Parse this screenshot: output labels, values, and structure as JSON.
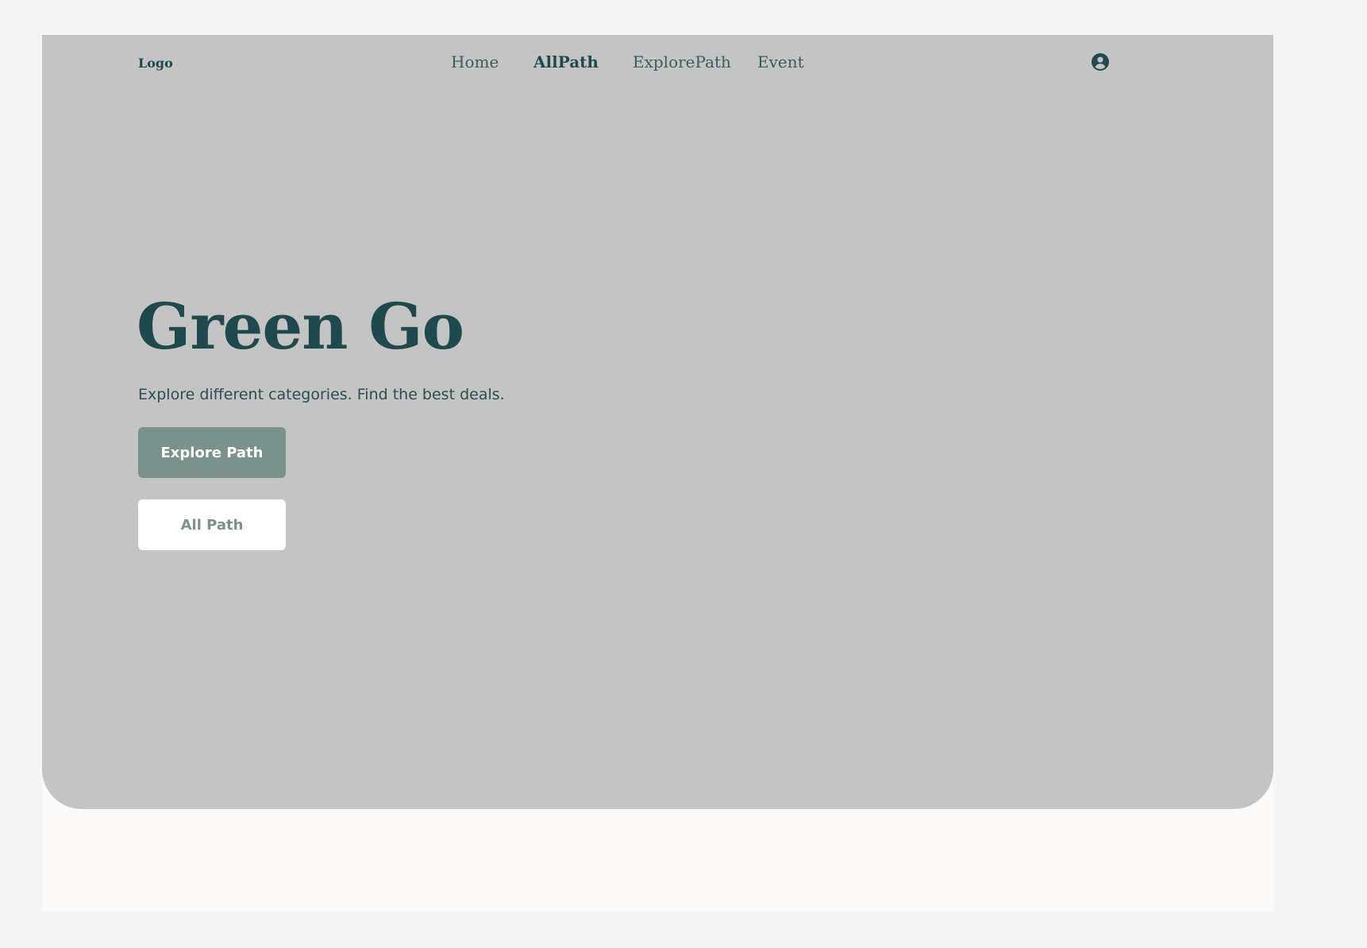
{
  "header": {
    "logo": "Logo",
    "nav": [
      "Home",
      "AllPath",
      "ExplorePath",
      "Event"
    ],
    "active_nav": "AllPath",
    "user_icon": "user-circle-icon"
  },
  "hero": {
    "title": "Green Go",
    "subtitle": "Explore different categories. Find the best deals.",
    "primary_button": "Explore Path",
    "secondary_button": "All Path"
  },
  "colors": {
    "page_background": "#f5f5f5",
    "hero_background": "#c4c4c4",
    "text_dark_green": "#1f4a4d",
    "button_primary": "#7b918c",
    "button_secondary_bg": "#ffffff",
    "content_background": "#fbfaf8"
  }
}
